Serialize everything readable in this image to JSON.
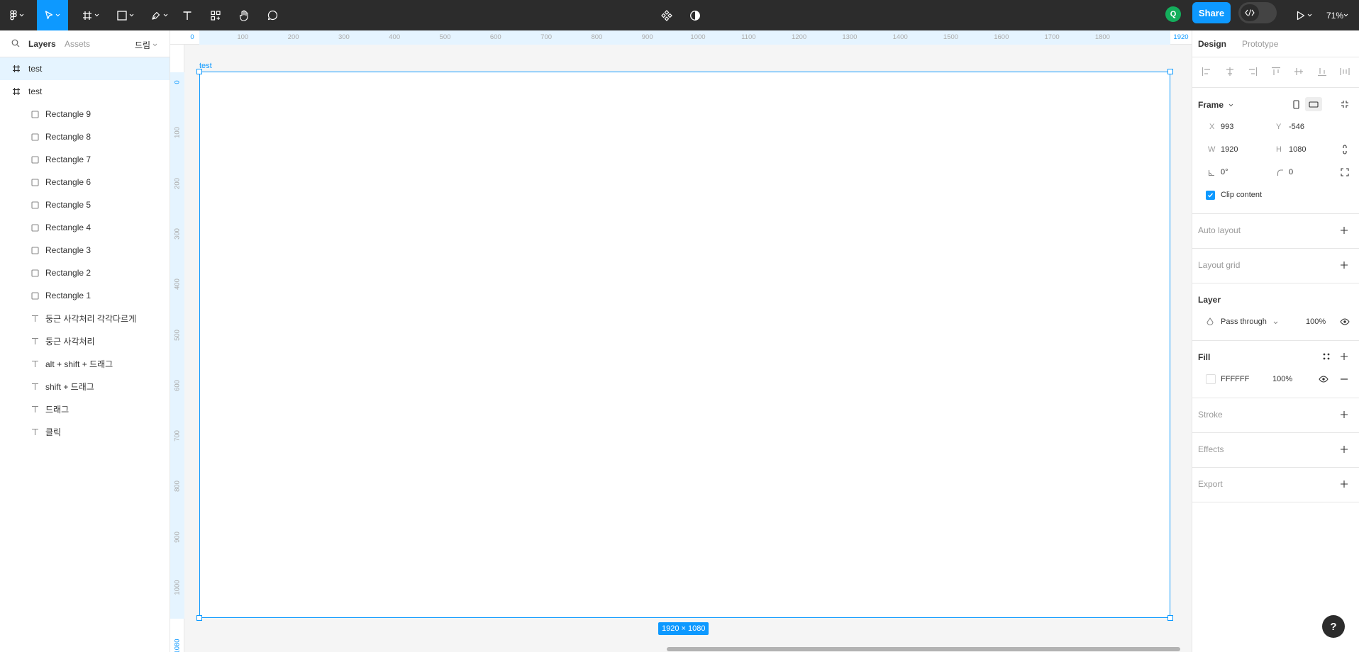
{
  "toolbar": {
    "share_label": "Share",
    "avatar_initial": "Q",
    "zoom": "71%"
  },
  "left_panel": {
    "tab_layers": "Layers",
    "tab_assets": "Assets",
    "page_selector": "드림",
    "layers": [
      {
        "label": "test",
        "type": "frame"
      },
      {
        "label": "test",
        "type": "frame"
      },
      {
        "label": "Rectangle 9",
        "type": "rectangle"
      },
      {
        "label": "Rectangle 8",
        "type": "rectangle"
      },
      {
        "label": "Rectangle 7",
        "type": "rectangle"
      },
      {
        "label": "Rectangle 6",
        "type": "rectangle"
      },
      {
        "label": "Rectangle 5",
        "type": "rectangle"
      },
      {
        "label": "Rectangle 4",
        "type": "rectangle"
      },
      {
        "label": "Rectangle 3",
        "type": "rectangle"
      },
      {
        "label": "Rectangle 2",
        "type": "rectangle"
      },
      {
        "label": "Rectangle 1",
        "type": "rectangle"
      },
      {
        "label": "둥근 사각처리 각각다르게",
        "type": "text"
      },
      {
        "label": "둥근 사각처리",
        "type": "text"
      },
      {
        "label": "alt + shift + 드래그",
        "type": "text"
      },
      {
        "label": "shift + 드래그",
        "type": "text"
      },
      {
        "label": "드래그",
        "type": "text"
      },
      {
        "label": "클릭",
        "type": "text"
      }
    ]
  },
  "canvas": {
    "ruler_top": [
      "0",
      "100",
      "200",
      "300",
      "400",
      "500",
      "600",
      "700",
      "800",
      "900",
      "1000",
      "1100",
      "1200",
      "1300",
      "1400",
      "1500",
      "1600",
      "1700",
      "1800",
      "1920"
    ],
    "ruler_left": [
      "0",
      "100",
      "200",
      "300",
      "400",
      "500",
      "600",
      "700",
      "800",
      "900",
      "1000",
      "1080"
    ],
    "frame_label": "test",
    "frame_dims": "1920 × 1080"
  },
  "right_panel": {
    "tab_design": "Design",
    "tab_prototype": "Prototype",
    "frame_title": "Frame",
    "x_label": "X",
    "x_value": "993",
    "y_label": "Y",
    "y_value": "-546",
    "w_label": "W",
    "w_value": "1920",
    "h_label": "H",
    "h_value": "1080",
    "rotation": "0°",
    "radius": "0",
    "clip_content": "Clip content",
    "auto_layout": "Auto layout",
    "layout_grid": "Layout grid",
    "layer_title": "Layer",
    "blend_mode": "Pass through",
    "layer_opacity": "100%",
    "fill_title": "Fill",
    "fill_hex": "FFFFFF",
    "fill_opacity": "100%",
    "stroke": "Stroke",
    "effects": "Effects",
    "export": "Export"
  },
  "help": "?",
  "colors": {
    "accent": "#0d99ff",
    "toolbar_bg": "#2c2c2c",
    "avatar": "#14ae5c",
    "fill_swatch": "#ffffff"
  }
}
